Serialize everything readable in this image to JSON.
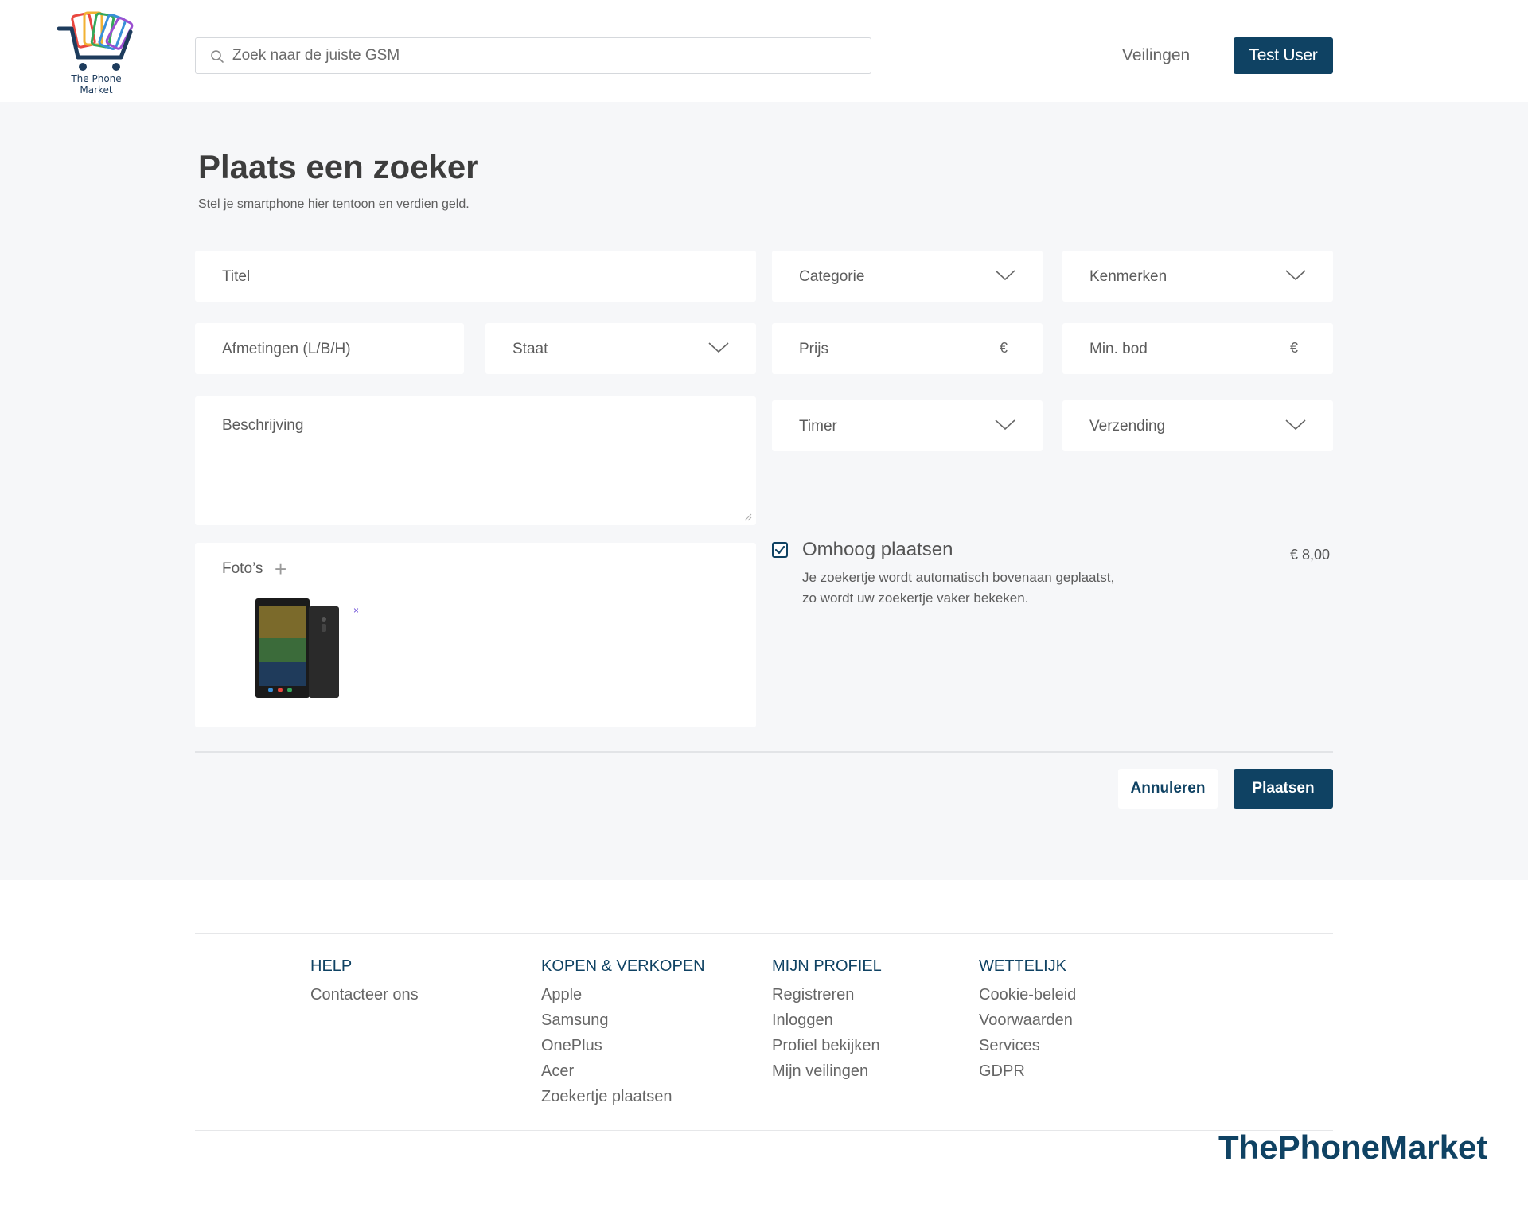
{
  "header": {
    "logo_text": "The Phone Market",
    "search_placeholder": "Zoek naar de juiste GSM",
    "nav_veilingen": "Veilingen",
    "user_button": "Test User"
  },
  "form": {
    "title": "Plaats een zoeker",
    "subtitle": "Stel je smartphone hier tentoon en verdien geld.",
    "titel": "Titel",
    "categorie": "Categorie",
    "kenmerken": "Kenmerken",
    "afmetingen": "Afmetingen (L/B/H)",
    "staat": "Staat",
    "prijs": "Prijs",
    "min_bod": "Min. bod",
    "currency": "€",
    "beschrijving": "Beschrijving",
    "timer": "Timer",
    "verzending": "Verzending",
    "fotos": "Foto’s",
    "remove_photo": "×",
    "boost": {
      "checked": true,
      "title": "Omhoog plaatsen",
      "description": "Je zoekertje wordt automatisch bovenaan geplaatst, zo wordt uw zoekertje vaker bekeken.",
      "price": "€ 8,00"
    },
    "cancel_button": "Annuleren",
    "submit_button": "Plaatsen"
  },
  "footer": {
    "columns": [
      {
        "heading": "HELP",
        "links": [
          "Contacteer ons"
        ]
      },
      {
        "heading": "KOPEN & VERKOPEN",
        "links": [
          "Apple",
          "Samsung",
          "OnePlus",
          "Acer",
          "Zoekertje plaatsen"
        ]
      },
      {
        "heading": "MIJN PROFIEL",
        "links": [
          "Registreren",
          "Inloggen",
          "Profiel bekijken",
          "Mijn veilingen"
        ]
      },
      {
        "heading": "WETTELIJK",
        "links": [
          "Cookie-beleid",
          "Voorwaarden",
          "Services",
          "GDPR"
        ]
      }
    ],
    "brand": "ThePhoneMarket"
  },
  "colors": {
    "accent": "#0f4263",
    "background": "#f6f7f9"
  }
}
